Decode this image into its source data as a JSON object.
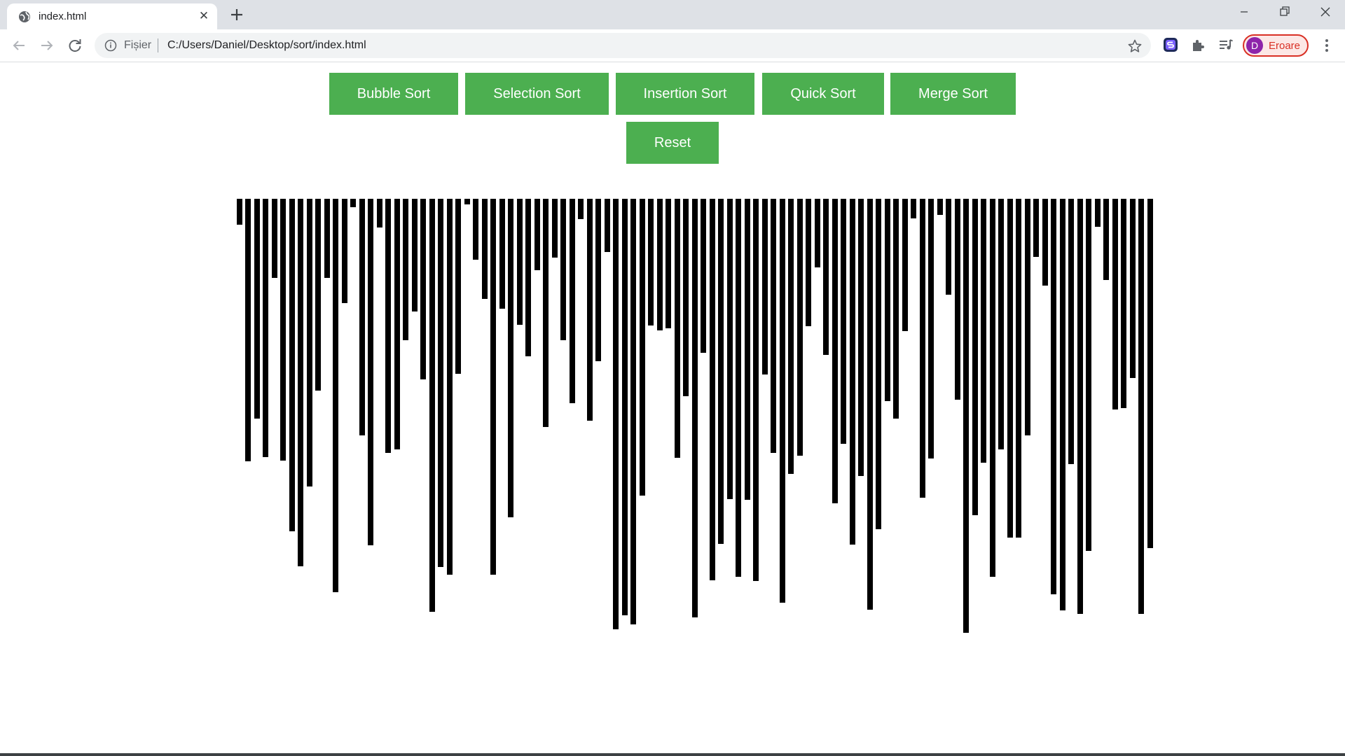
{
  "browser": {
    "tab_title": "index.html",
    "scheme_label": "Fișier",
    "url": "C:/Users/Daniel/Desktop/sort/index.html",
    "profile_initial": "D",
    "profile_label": "Eroare"
  },
  "page": {
    "buttons": {
      "bubble": "Bubble Sort",
      "selection": "Selection Sort",
      "insertion": "Insertion Sort",
      "quick": "Quick Sort",
      "merge": "Merge Sort",
      "reset": "Reset"
    },
    "bar_color": "#000000",
    "button_color": "#4caf50",
    "bar_values": [
      37,
      375,
      314,
      369,
      113,
      374,
      475,
      525,
      411,
      274,
      113,
      562,
      149,
      12,
      338,
      495,
      41,
      363,
      358,
      202,
      161,
      258,
      590,
      526,
      537,
      250,
      8,
      87,
      143,
      537,
      157,
      455,
      180,
      225,
      102,
      326,
      84,
      202,
      292,
      29,
      317,
      232,
      76,
      615,
      595,
      608,
      424,
      181,
      188,
      185,
      370,
      282,
      598,
      220,
      545,
      493,
      429,
      540,
      430,
      546,
      251,
      363,
      577,
      393,
      367,
      182,
      98,
      223,
      435,
      350,
      494,
      396,
      587,
      472,
      289,
      314,
      189,
      28,
      427,
      371,
      23,
      137,
      287,
      620,
      452,
      377,
      540,
      358,
      484,
      484,
      338,
      83,
      124,
      565,
      588,
      379,
      593,
      503,
      40,
      116,
      301,
      299,
      256,
      593,
      499
    ]
  }
}
